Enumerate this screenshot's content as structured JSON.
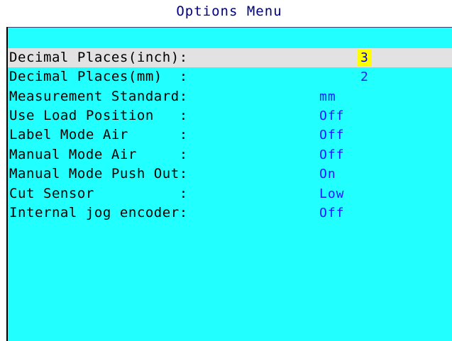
{
  "title": "Options Menu",
  "options": [
    {
      "label": "Decimal Places(inch):",
      "value": "3"
    },
    {
      "label": "Decimal Places(mm)  :",
      "value": "2"
    },
    {
      "label": "Measurement Standard:",
      "value": "mm"
    },
    {
      "label": "Use Load Position   :",
      "value": "Off"
    },
    {
      "label": "Label Mode Air      :",
      "value": "Off"
    },
    {
      "label": "Manual Mode Air     :",
      "value": "Off"
    },
    {
      "label": "Manual Mode Push Out:",
      "value": "On"
    },
    {
      "label": "Cut Sensor          :",
      "value": "Low"
    },
    {
      "label": "Internal jog encoder:",
      "value": "Off"
    }
  ],
  "colors": {
    "panel": "#22ffff",
    "label_text": "#000000",
    "value_text": "#1a1aff",
    "title_text": "#000080",
    "selected_row": "#e2e2e2",
    "selected_value": "#ffff00"
  }
}
